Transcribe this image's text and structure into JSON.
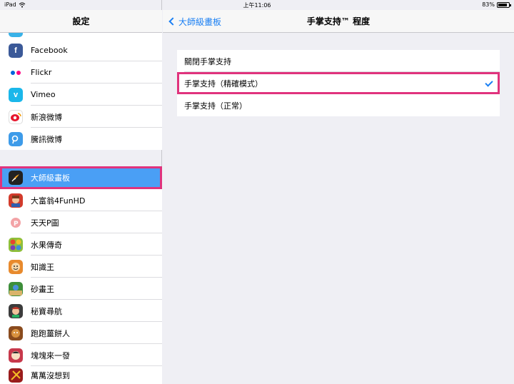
{
  "status_bar": {
    "device": "iPad",
    "time": "上午11:06",
    "battery": "83%",
    "battery_level": 0.83
  },
  "sidebar": {
    "title": "設定",
    "items": [
      {
        "label": "Facebook",
        "icon": "facebook-icon",
        "color": "#3b5998"
      },
      {
        "label": "Flickr",
        "icon": "flickr-icon",
        "color": "#ffffff"
      },
      {
        "label": "Vimeo",
        "icon": "vimeo-icon",
        "color": "#1ab7ea"
      },
      {
        "label": "新浪微博",
        "icon": "sina-weibo-icon",
        "color": "#ffffff"
      },
      {
        "label": "騰訊微博",
        "icon": "tencent-weibo-icon",
        "color": "#3d9be9"
      },
      {
        "label": "大師級畫板",
        "icon": "brush-app-icon",
        "color": "#222222",
        "selected": true
      },
      {
        "label": "大富翁4FunHD",
        "icon": "game-icon",
        "color": "#d23b2b"
      },
      {
        "label": "天天P圖",
        "icon": "photo-app-icon",
        "color": "#ffffff"
      },
      {
        "label": "水果傳奇",
        "icon": "fruit-game-icon",
        "color": "#8fbf3a"
      },
      {
        "label": "知識王",
        "icon": "quiz-game-icon",
        "color": "#e88a2d"
      },
      {
        "label": "砂畫王",
        "icon": "sand-game-icon",
        "color": "#3d8e3a"
      },
      {
        "label": "秘寶尋航",
        "icon": "treasure-game-icon",
        "color": "#3c3c3c"
      },
      {
        "label": "跑跑薑餅人",
        "icon": "cookie-game-icon",
        "color": "#8a4b1e"
      },
      {
        "label": "塊塊來一發",
        "icon": "block-game-icon",
        "color": "#c7384b"
      },
      {
        "label": "萬萬沒想到",
        "icon": "movie-game-icon",
        "color": "#9a1c1c"
      }
    ]
  },
  "detail": {
    "back_label": "大師級畫板",
    "title": "手掌支持™ 程度",
    "options": [
      {
        "label": "關閉手掌支持",
        "checked": false
      },
      {
        "label": "手掌支持（精確模式）",
        "checked": true
      },
      {
        "label": "手掌支持（正常）",
        "checked": false
      }
    ]
  },
  "colors": {
    "accent": "#1a7ff3",
    "selection": "#4a9ff5",
    "highlight": "#e0337d"
  }
}
